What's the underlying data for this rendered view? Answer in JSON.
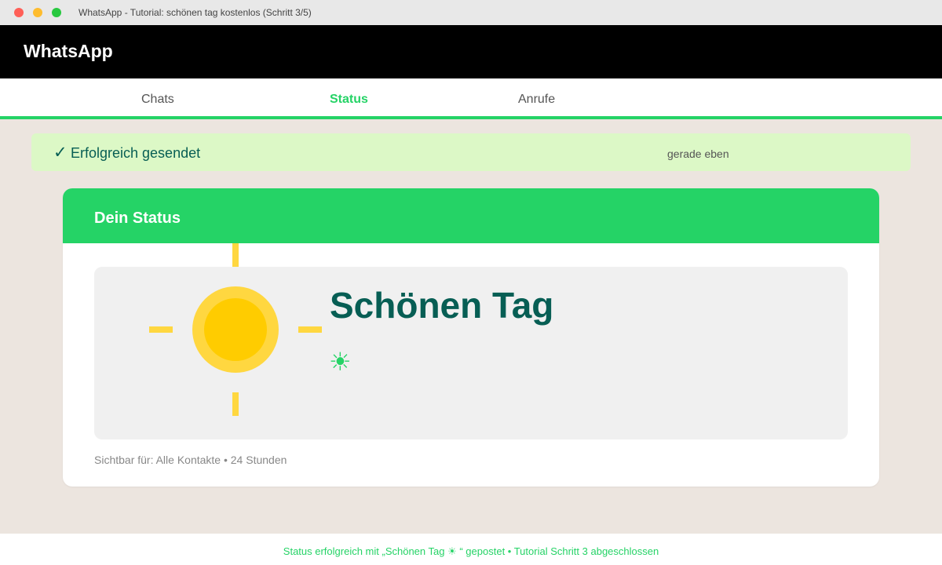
{
  "window": {
    "title": "WhatsApp - Tutorial: schönen tag kostenlos (Schritt 3/5)"
  },
  "app": {
    "title": "WhatsApp"
  },
  "tabs": [
    {
      "label": "Chats",
      "active": false
    },
    {
      "label": "Status",
      "active": true
    },
    {
      "label": "Anrufe",
      "active": false
    }
  ],
  "toast": {
    "icon": "✓",
    "icon_name": "checkmark-icon",
    "message": "Erfolgreich gesendet",
    "time": "gerade eben"
  },
  "card": {
    "title": "Dein Status",
    "status_text": "Schönen Tag",
    "status_emoji": "☀",
    "image_icon": "sun-icon",
    "visibility": "Sichtbar für: Alle Kontakte • 24 Stunden"
  },
  "footer": {
    "message": "Status erfolgreich mit „Schönen Tag ☀ “ gepostet • Tutorial Schritt 3 abgeschlossen"
  },
  "colors": {
    "brand_green": "#25d366",
    "dark_teal": "#075e54",
    "toast_bg": "#dcf8c6",
    "sun_outer": "#ffd740",
    "sun_inner": "#ffcc00",
    "app_bar": "#000000",
    "page_bg": "#ece5df"
  }
}
